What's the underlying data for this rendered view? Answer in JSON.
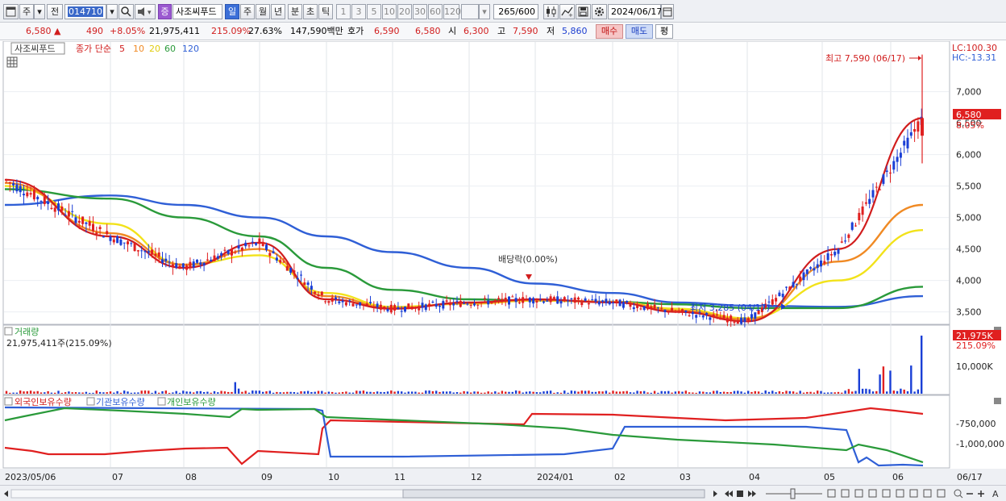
{
  "toolbar": {
    "period_main": "주",
    "prev_label": "전",
    "stock_code": "014710",
    "stock_name": "사조씨푸드",
    "badge": "증",
    "period_tabs": [
      "일",
      "주",
      "월",
      "년",
      "분",
      "초",
      "틱"
    ],
    "active_period": "일",
    "interval_buttons": [
      "1",
      "3",
      "5",
      "10",
      "20",
      "30",
      "60",
      "120"
    ],
    "count_current": "265",
    "count_total": "/600",
    "date": "2024/06/17"
  },
  "quote": {
    "price": "6,580",
    "arrow": "▲",
    "change": "490",
    "change_pct": "+8.05%",
    "volume": "21,975,411",
    "volume_ratio": "215.09%",
    "turnover": "27.63%",
    "amount": "147,590백만",
    "ask_label": "호가",
    "ask_value": "6,590",
    "bid_value": "6,580",
    "open_label": "시",
    "open_value": "6,300",
    "high_label": "고",
    "high_value": "7,590",
    "low_label": "저",
    "low_value": "5,860",
    "buy_button": "매수",
    "sell_button": "매도",
    "eval_button": "평"
  },
  "price_panel": {
    "name_label": "사조씨푸드",
    "ma_title": "종가 단순",
    "ma_periods": [
      "5",
      "10",
      "20",
      "60",
      "120"
    ],
    "lc_label": "LC:100.30",
    "hc_label": "HC:-13.31",
    "max_label": "최고 7,590 (06/17)",
    "min_label": "최저 3,285 (04/17)",
    "dividend_label": "배당락(0.00%)",
    "current_price_tag": "6,580",
    "current_pct_tag": "8.05%",
    "y_ticks": [
      "7,000",
      "6,500",
      "6,000",
      "5,500",
      "5,000",
      "4,500",
      "4,000",
      "3,500"
    ]
  },
  "volume_panel": {
    "title": "거래량",
    "value_label": "21,975,411주(215.09%)",
    "current_tag": "21,975K",
    "current_pct": "215.09%",
    "y_tick": "10,000K"
  },
  "holding_panel": {
    "legend": [
      "외국인보유수량",
      "기관보유수량",
      "개인보유수량"
    ],
    "y_ticks": [
      "-750,000",
      "-1,000,000"
    ]
  },
  "x_axis": {
    "labels": [
      "2023/05/06",
      "07",
      "08",
      "09",
      "10",
      "11",
      "12",
      "2024/01",
      "02",
      "03",
      "04",
      "05",
      "06",
      "06/17"
    ]
  },
  "colors": {
    "ma5": "#d11d1d",
    "ma10": "#f08a24",
    "ma20": "#f2e21a",
    "ma60": "#2a9a3a",
    "ma120": "#2f5fd6",
    "up": "#e02020",
    "down": "#1a3fd6"
  },
  "chart_data": {
    "type": "line",
    "x": [
      "2023-05",
      "2023-07",
      "2023-08",
      "2023-09",
      "2023-10",
      "2023-11",
      "2023-12",
      "2024-01",
      "2024-02",
      "2024-03",
      "2024-04",
      "2024-05",
      "2024-06"
    ],
    "series": [
      {
        "name": "5",
        "values": [
          5600,
          4700,
          4200,
          4600,
          3700,
          3550,
          3650,
          3700,
          3650,
          3500,
          3350,
          4500,
          6580
        ]
      },
      {
        "name": "10",
        "values": [
          5550,
          4750,
          4250,
          4500,
          3750,
          3560,
          3640,
          3690,
          3660,
          3520,
          3380,
          4300,
          5200
        ]
      },
      {
        "name": "20",
        "values": [
          5500,
          4900,
          4250,
          4400,
          3800,
          3580,
          3630,
          3680,
          3660,
          3550,
          3400,
          4000,
          4800
        ]
      },
      {
        "name": "60",
        "values": [
          5450,
          5300,
          5000,
          4700,
          4200,
          3850,
          3700,
          3680,
          3660,
          3620,
          3560,
          3560,
          3900
        ]
      },
      {
        "name": "120",
        "values": [
          5200,
          5350,
          5200,
          5000,
          4700,
          4450,
          4200,
          3950,
          3800,
          3650,
          3600,
          3580,
          3750
        ]
      }
    ],
    "ylim": [
      3200,
      7700
    ]
  }
}
